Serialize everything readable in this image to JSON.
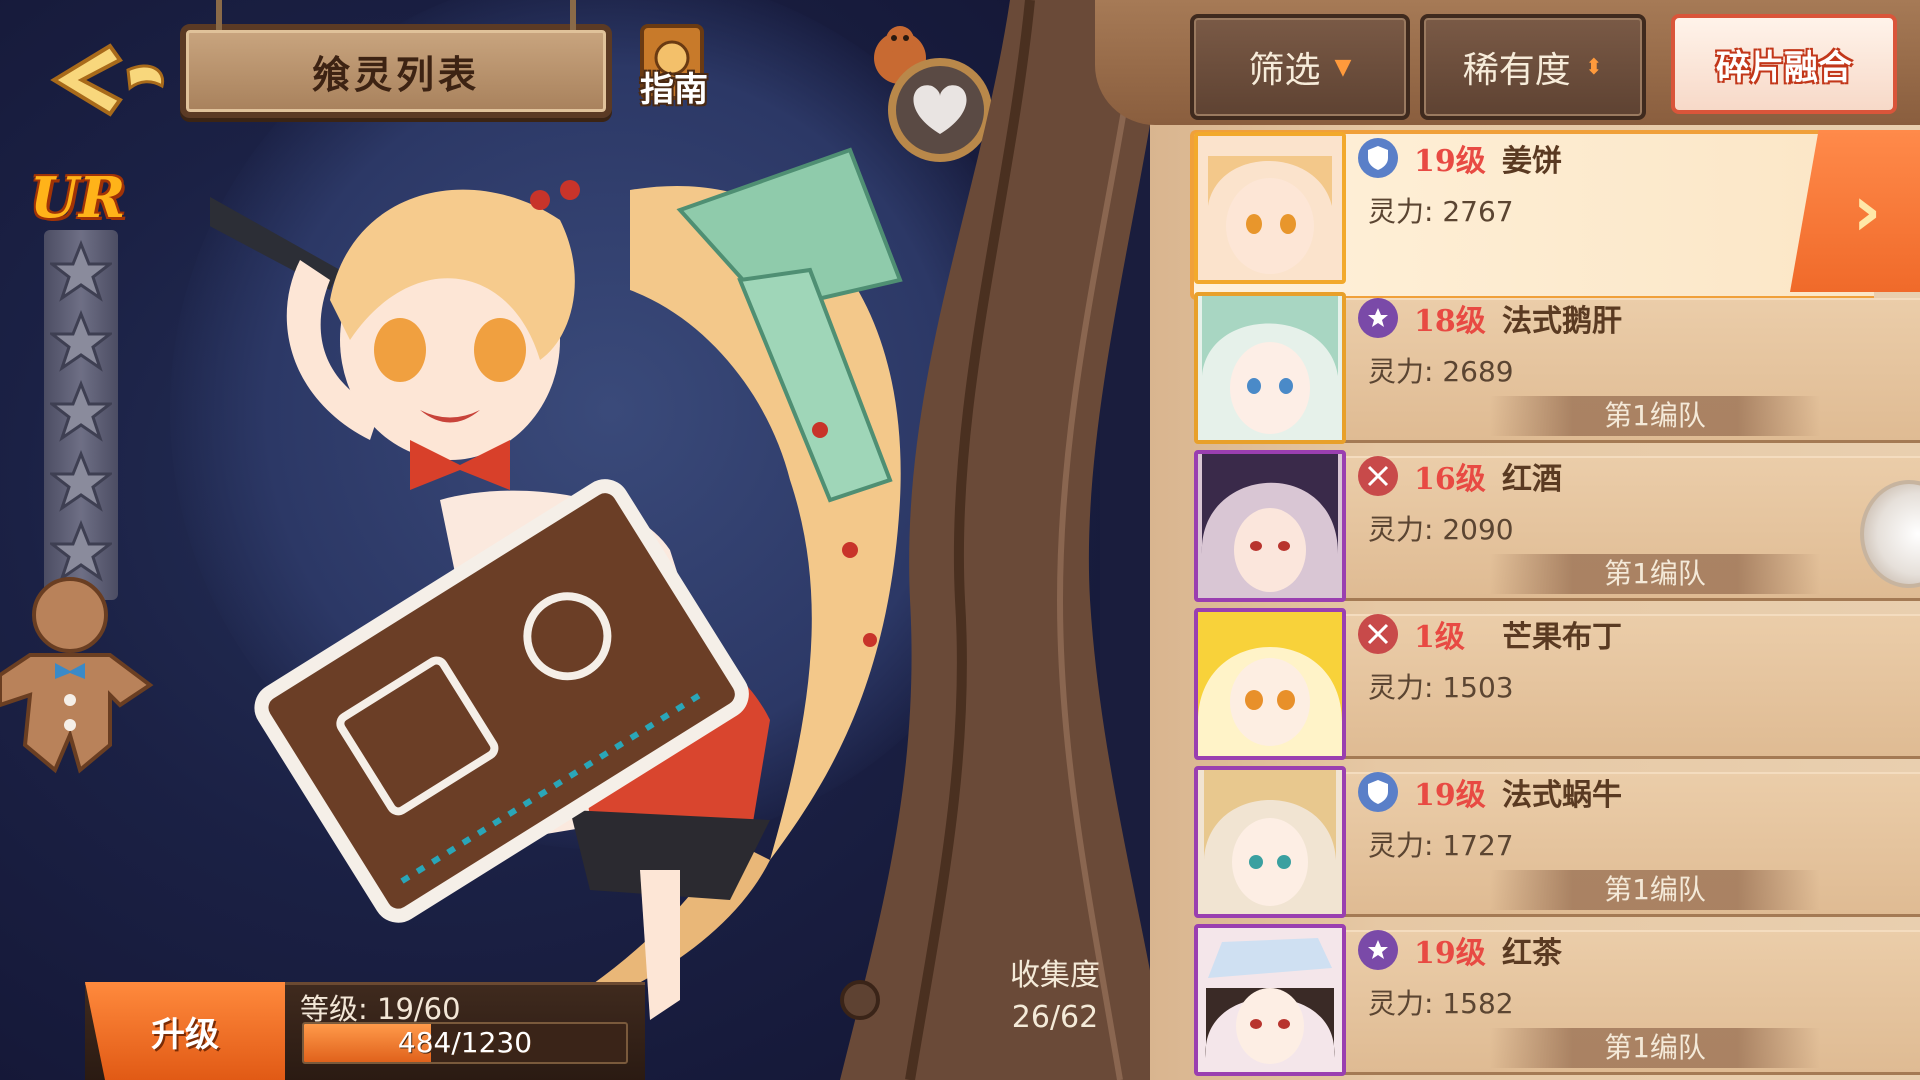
{
  "header": {
    "title": "飨灵列表",
    "guide_label": "指南"
  },
  "rarity": "UR",
  "stars": 5,
  "level_panel": {
    "upgrade_label": "升级",
    "level_text": "等级: 19/60",
    "exp_text": "484/1230",
    "exp_fraction": 0.393
  },
  "collection": {
    "label": "收集度",
    "value": "26/62"
  },
  "toolbar": {
    "filter_label": "筛选",
    "rarity_label": "稀有度",
    "fuse_label": "碎片融合"
  },
  "colors": {
    "accent": "#f06a2a",
    "level_red": "#e84a43",
    "panel_tan": "#e6c8a4",
    "frame_purple": "#9a3fb0",
    "frame_gold": "#f2a92c"
  },
  "cards": [
    {
      "level": "19级",
      "name": "姜饼",
      "power": "灵力: 2767",
      "team": "",
      "badge": "shield-icon",
      "frame": "gold",
      "selected": true
    },
    {
      "level": "18级",
      "name": "法式鹅肝",
      "power": "灵力: 2689",
      "team": "第1编队",
      "badge": "star-badge-icon",
      "frame": "orange",
      "selected": false
    },
    {
      "level": "16级",
      "name": "红酒",
      "power": "灵力: 2090",
      "team": "第1编队",
      "badge": "swords-icon",
      "frame": "purple",
      "selected": false
    },
    {
      "level": "1级",
      "name": "芒果布丁",
      "power": "灵力: 1503",
      "team": "",
      "badge": "swords-icon",
      "frame": "purple",
      "selected": false
    },
    {
      "level": "19级",
      "name": "法式蜗牛",
      "power": "灵力: 1727",
      "team": "第1编队",
      "badge": "shield-icon",
      "frame": "purple",
      "selected": false
    },
    {
      "level": "19级",
      "name": "红茶",
      "power": "灵力: 1582",
      "team": "第1编队",
      "badge": "star-badge-icon",
      "frame": "purple",
      "selected": false
    }
  ]
}
